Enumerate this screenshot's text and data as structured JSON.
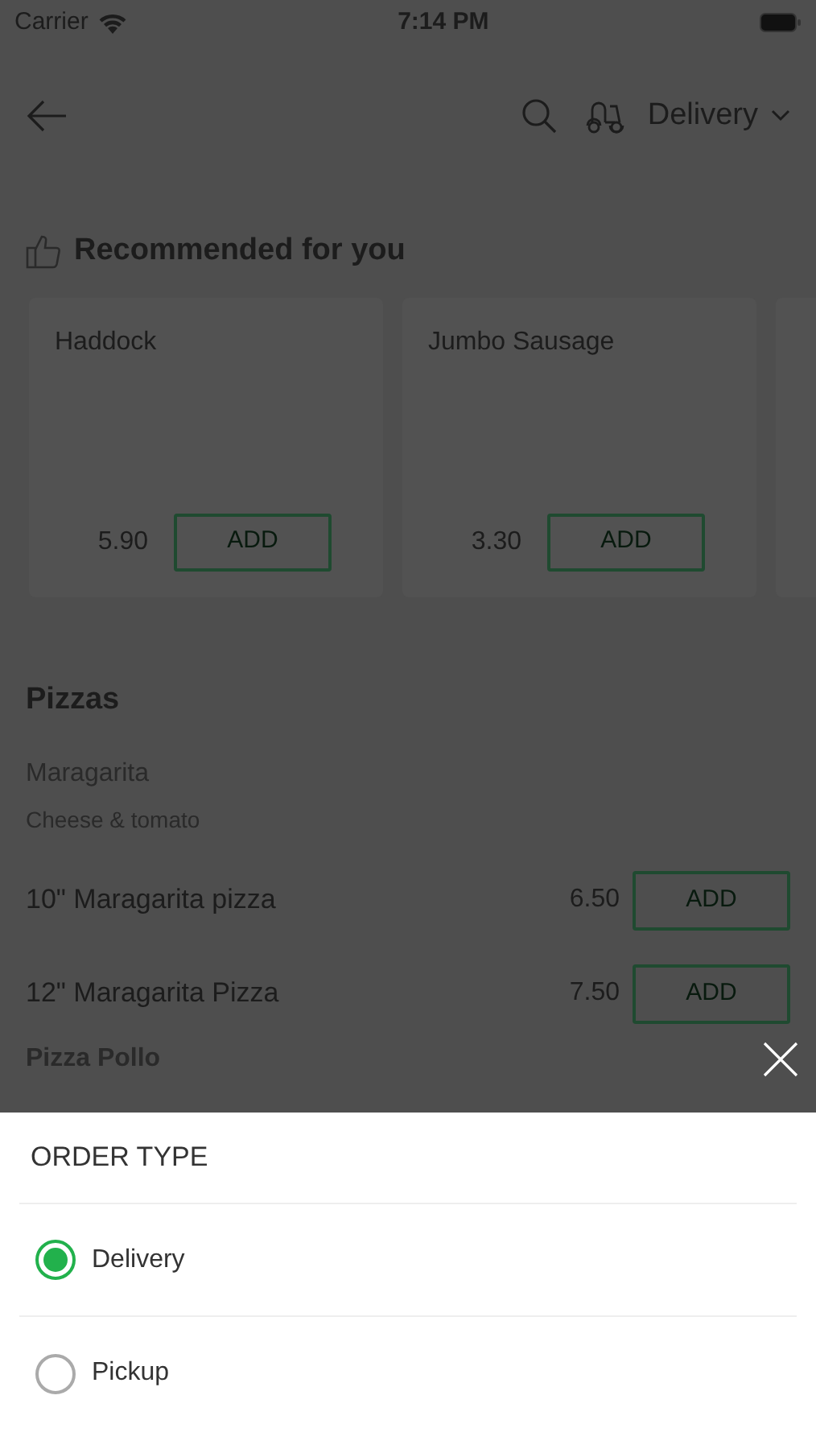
{
  "status_bar": {
    "carrier": "Carrier",
    "time": "7:14 PM"
  },
  "header": {
    "order_type": "Delivery"
  },
  "recommended": {
    "title": "Recommended for you",
    "items": [
      {
        "name": "Haddock",
        "price": "5.90",
        "button": "ADD"
      },
      {
        "name": "Jumbo Sausage",
        "price": "3.30",
        "button": "ADD"
      }
    ]
  },
  "section": {
    "title": "Pizzas",
    "group": {
      "name": "Maragarita",
      "description": "Cheese & tomato"
    },
    "items": [
      {
        "name": "10\" Maragarita pizza",
        "price": "6.50",
        "button": "ADD"
      },
      {
        "name": "12\" Maragarita Pizza",
        "price": "7.50",
        "button": "ADD"
      }
    ],
    "next_group": "Pizza Pollo"
  },
  "sheet": {
    "title": "ORDER TYPE",
    "options": [
      {
        "label": "Delivery",
        "selected": true
      },
      {
        "label": "Pickup",
        "selected": false
      }
    ]
  }
}
